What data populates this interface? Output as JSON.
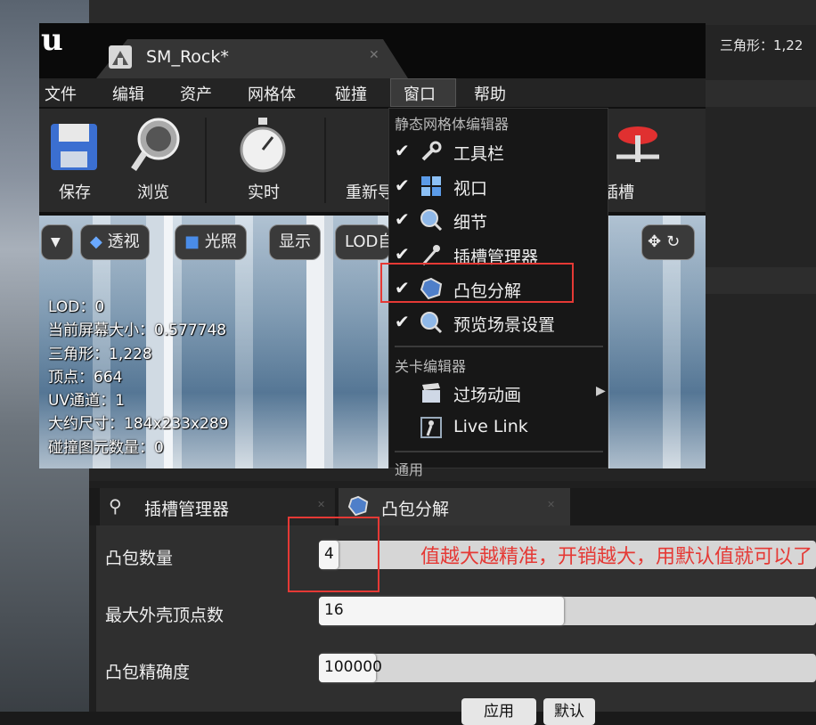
{
  "background": {
    "triangles_text": "三角形：1,22"
  },
  "window": {
    "tab_title": "SM_Rock*",
    "menu": [
      "文件",
      "编辑",
      "资产",
      "网格体",
      "碰撞",
      "窗口",
      "帮助"
    ],
    "toolbar": [
      {
        "label": "保存",
        "icon": "save-icon"
      },
      {
        "label": "浏览",
        "icon": "browse-icon"
      },
      {
        "label": "实时",
        "icon": "stopwatch-icon"
      },
      {
        "label": "重新导",
        "icon": "reimport-icon"
      },
      {
        "label": "插槽",
        "icon": "socket-icon"
      }
    ],
    "viewport_buttons": {
      "perspective": "透视",
      "lighting": "光照",
      "show": "显示",
      "lod": "LOD自"
    },
    "stats": [
      "LOD：0",
      "当前屏幕大小：0.577748",
      "三角形：1,228",
      "顶点：664",
      "UV通道：1",
      "大约尺寸：184x233x289",
      "碰撞图元数量：0"
    ]
  },
  "dropdown": {
    "section1": "静态网格体编辑器",
    "items1": [
      {
        "label": "工具栏",
        "icon": "wrench-icon",
        "checked": true
      },
      {
        "label": "视口",
        "icon": "viewport-icon",
        "checked": true
      },
      {
        "label": "细节",
        "icon": "details-icon",
        "checked": true
      },
      {
        "label": "插槽管理器",
        "icon": "socket-manager-icon",
        "checked": true
      },
      {
        "label": "凸包分解",
        "icon": "convex-icon",
        "checked": true
      },
      {
        "label": "预览场景设置",
        "icon": "details-icon",
        "checked": true
      }
    ],
    "section2": "关卡编辑器",
    "items2": [
      {
        "label": "过场动画",
        "icon": "clapper-icon"
      },
      {
        "label": "Live Link",
        "icon": "live-link-icon"
      }
    ],
    "section3": "通用"
  },
  "bottom_panel": {
    "tabs": [
      "插槽管理器",
      "凸包分解"
    ],
    "props": [
      {
        "label": "凸包数量",
        "value": "4",
        "fill": 0.04
      },
      {
        "label": "最大外壳顶点数",
        "value": "16",
        "fill": 0.5
      },
      {
        "label": "凸包精确度",
        "value": "100000",
        "fill": 0.12
      }
    ],
    "buttons": [
      "应用",
      "默认"
    ],
    "note": "值越大越精准，开销越大，用默认值就可以了"
  },
  "colors": {
    "annotation": "#e53935",
    "panel": "#2f2f2f"
  }
}
